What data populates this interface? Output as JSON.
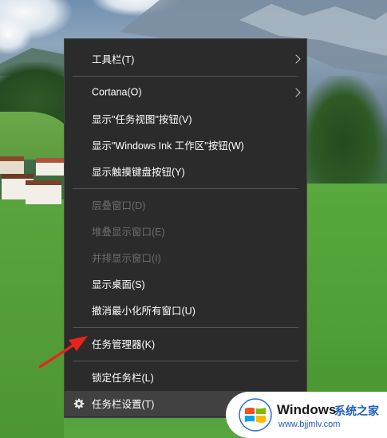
{
  "context_menu": {
    "items": [
      {
        "label": "工具栏(T)",
        "submenu": true,
        "enabled": true
      },
      {
        "label": "Cortana(O)",
        "submenu": true,
        "enabled": true
      },
      {
        "label": "显示\"任务视图\"按钮(V)",
        "enabled": true
      },
      {
        "label": "显示\"Windows Ink 工作区\"按钮(W)",
        "enabled": true
      },
      {
        "label": "显示触摸键盘按钮(Y)",
        "enabled": true
      },
      {
        "label": "层叠窗口(D)",
        "enabled": false
      },
      {
        "label": "堆叠显示窗口(E)",
        "enabled": false
      },
      {
        "label": "并排显示窗口(I)",
        "enabled": false
      },
      {
        "label": "显示桌面(S)",
        "enabled": true
      },
      {
        "label": "撤消最小化所有窗口(U)",
        "enabled": true
      },
      {
        "label": "任务管理器(K)",
        "enabled": true,
        "highlighted_by_arrow": true
      },
      {
        "label": "锁定任务栏(L)",
        "enabled": true
      },
      {
        "label": "任务栏设置(T)",
        "enabled": true,
        "hovered": true,
        "icon": "gear-icon"
      }
    ]
  },
  "annotation": {
    "arrow_color": "#e8241c"
  },
  "watermark": {
    "brand": "Windows",
    "brand_cn": "系统之家",
    "url": "www.bjjmlv.com",
    "logo_icon": "windows-logo-icon"
  },
  "colors": {
    "menu_bg": "#2b2b2b",
    "menu_hover": "#414141",
    "menu_text": "#ffffff",
    "menu_disabled_text": "#6d6d6d"
  }
}
